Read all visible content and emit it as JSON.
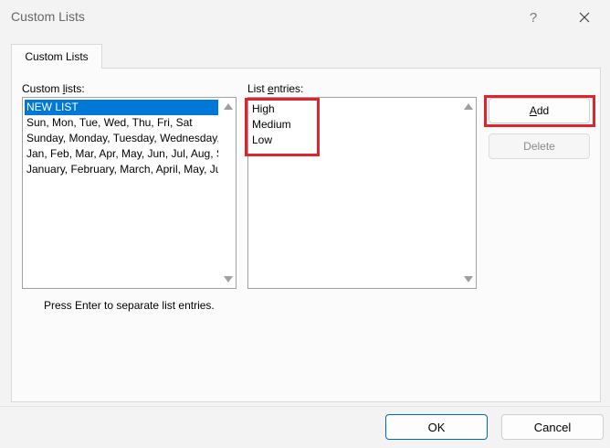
{
  "window": {
    "title": "Custom Lists",
    "help_label": "?",
    "close_icon": "close-icon"
  },
  "tabs": [
    {
      "label": "Custom Lists",
      "active": true
    }
  ],
  "custom_lists": {
    "label_prefix": "Custom ",
    "label_accel": "l",
    "label_suffix": "ists:",
    "items": [
      "NEW LIST",
      "Sun, Mon, Tue, Wed, Thu, Fri, Sat",
      "Sunday, Monday, Tuesday, Wednesday, Thursday, Friday, Saturday",
      "Jan, Feb, Mar, Apr, May, Jun, Jul, Aug, Sep, Oct, Nov, Dec",
      "January, February, March, April, May, June, July, August, September, October, November, December"
    ],
    "selected_index": 0
  },
  "list_entries": {
    "label_prefix": "List ",
    "label_accel": "e",
    "label_suffix": "ntries:",
    "entries": [
      "High",
      "Medium",
      "Low"
    ]
  },
  "buttons": {
    "add_label_accel": "A",
    "add_label_rest": "dd",
    "delete_label": "Delete",
    "ok_label": "OK",
    "cancel_label": "Cancel"
  },
  "hint_text": "Press Enter to separate list entries.",
  "colors": {
    "selection": "#0078d7",
    "highlight": "#e0242b",
    "ok_border": "#0067c0"
  }
}
